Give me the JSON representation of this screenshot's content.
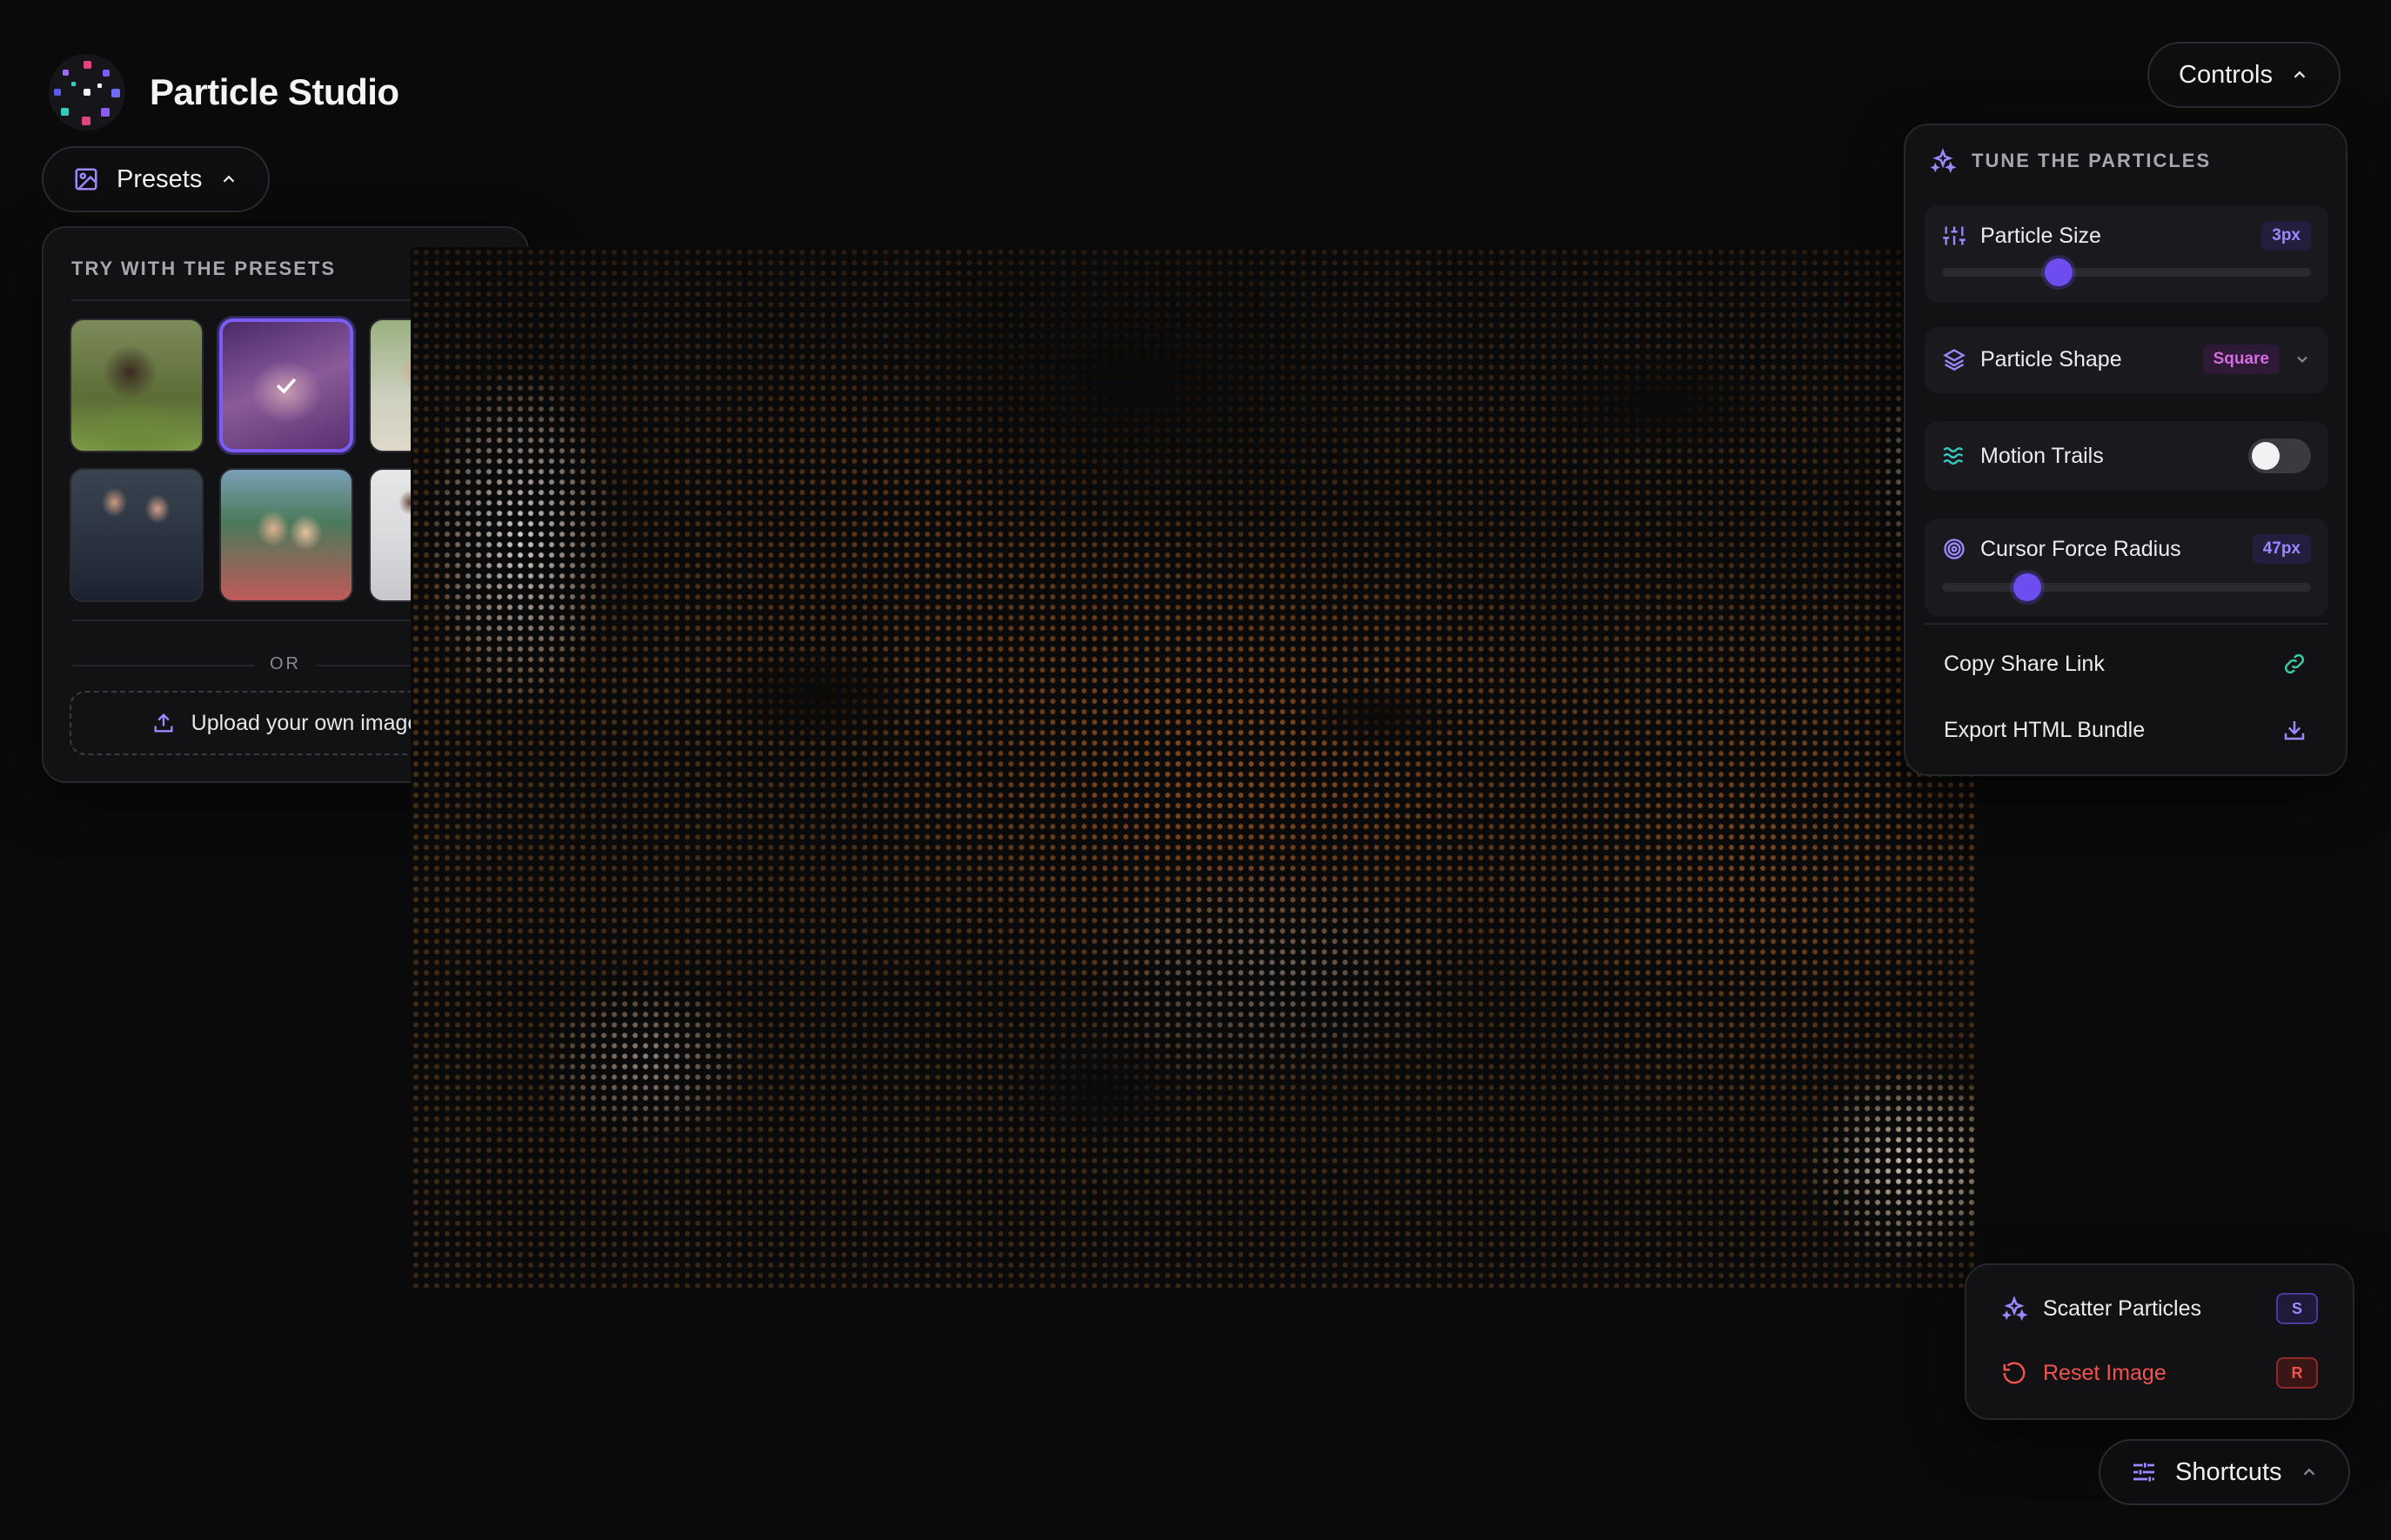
{
  "app": {
    "title": "Particle Studio"
  },
  "presets": {
    "toggle_label": "Presets",
    "section_title": "TRY WITH THE PRESETS",
    "thumbnails": [
      {
        "name": "bear",
        "selected": false
      },
      {
        "name": "fox",
        "selected": true
      },
      {
        "name": "family",
        "selected": false
      },
      {
        "name": "business-couple",
        "selected": false
      },
      {
        "name": "selfie",
        "selected": false
      },
      {
        "name": "team",
        "selected": false
      }
    ],
    "divider_label": "OR",
    "upload_label": "Upload your own image"
  },
  "controls": {
    "toggle_label": "Controls",
    "section_title": "TUNE THE PARTICLES",
    "particle_size": {
      "label": "Particle Size",
      "value": "3px",
      "level": 0.3
    },
    "particle_shape": {
      "label": "Particle Shape",
      "value": "Square"
    },
    "motion_trails": {
      "label": "Motion Trails",
      "enabled": false
    },
    "cursor_force_radius": {
      "label": "Cursor Force Radius",
      "value": "47px",
      "level": 0.21
    },
    "copy_share_link": "Copy Share Link",
    "export_html_bundle": "Export HTML Bundle"
  },
  "shortcuts": {
    "toggle_label": "Shortcuts",
    "scatter": {
      "label": "Scatter Particles",
      "key": "S"
    },
    "reset": {
      "label": "Reset Image",
      "key": "R"
    }
  },
  "colors": {
    "accent": "#7c5cf4",
    "danger": "#f0534d",
    "teal": "#38c9c0",
    "background": "#0a0a0a"
  }
}
